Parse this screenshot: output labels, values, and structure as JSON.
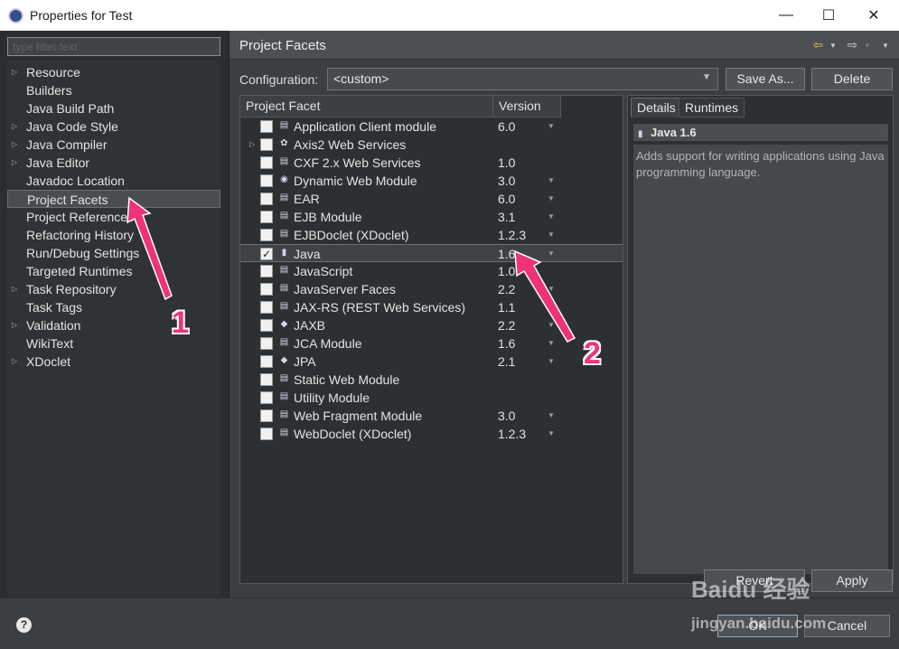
{
  "window": {
    "title": "Properties for Test",
    "minimize": "—",
    "maximize": "☐",
    "close": "✕"
  },
  "filter": {
    "placeholder": "type filter text"
  },
  "tree": {
    "items": [
      {
        "label": "Resource",
        "expandable": true
      },
      {
        "label": "Builders",
        "expandable": false
      },
      {
        "label": "Java Build Path",
        "expandable": false
      },
      {
        "label": "Java Code Style",
        "expandable": true
      },
      {
        "label": "Java Compiler",
        "expandable": true
      },
      {
        "label": "Java Editor",
        "expandable": true
      },
      {
        "label": "Javadoc Location",
        "expandable": false
      },
      {
        "label": "Project Facets",
        "expandable": false,
        "selected": true
      },
      {
        "label": "Project References",
        "expandable": false
      },
      {
        "label": "Refactoring History",
        "expandable": false
      },
      {
        "label": "Run/Debug Settings",
        "expandable": false
      },
      {
        "label": "Targeted Runtimes",
        "expandable": false
      },
      {
        "label": "Task Repository",
        "expandable": true
      },
      {
        "label": "Task Tags",
        "expandable": false
      },
      {
        "label": "Validation",
        "expandable": true
      },
      {
        "label": "WikiText",
        "expandable": false
      },
      {
        "label": "XDoclet",
        "expandable": true
      }
    ]
  },
  "header": {
    "title": "Project Facets",
    "back_icon": "back-arrow-icon",
    "forward_icon": "forward-arrow-icon"
  },
  "configuration": {
    "label": "Configuration:",
    "value": "<custom>",
    "save_as": "Save As...",
    "delete": "Delete"
  },
  "facets": {
    "col_facet": "Project Facet",
    "col_version": "Version",
    "rows": [
      {
        "name": "Application Client module",
        "version": "6.0",
        "checked": false,
        "chevron": true
      },
      {
        "name": "Axis2 Web Services",
        "version": "",
        "checked": false,
        "expand": true
      },
      {
        "name": "CXF 2.x Web Services",
        "version": "1.0",
        "checked": false
      },
      {
        "name": "Dynamic Web Module",
        "version": "3.0",
        "checked": false,
        "chevron": true
      },
      {
        "name": "EAR",
        "version": "6.0",
        "checked": false,
        "chevron": true
      },
      {
        "name": "EJB Module",
        "version": "3.1",
        "checked": false,
        "chevron": true
      },
      {
        "name": "EJBDoclet (XDoclet)",
        "version": "1.2.3",
        "checked": false,
        "chevron": true
      },
      {
        "name": "Java",
        "version": "1.6",
        "checked": true,
        "chevron": true,
        "selected": true
      },
      {
        "name": "JavaScript",
        "version": "1.0",
        "checked": false
      },
      {
        "name": "JavaServer Faces",
        "version": "2.2",
        "checked": false,
        "chevron": true
      },
      {
        "name": "JAX-RS (REST Web Services)",
        "version": "1.1",
        "checked": false
      },
      {
        "name": "JAXB",
        "version": "2.2",
        "checked": false,
        "chevron": true
      },
      {
        "name": "JCA Module",
        "version": "1.6",
        "checked": false,
        "chevron": true
      },
      {
        "name": "JPA",
        "version": "2.1",
        "checked": false,
        "chevron": true
      },
      {
        "name": "Static Web Module",
        "version": "",
        "checked": false
      },
      {
        "name": "Utility Module",
        "version": "",
        "checked": false
      },
      {
        "name": "Web Fragment Module",
        "version": "3.0",
        "checked": false,
        "chevron": true
      },
      {
        "name": "WebDoclet (XDoclet)",
        "version": "1.2.3",
        "checked": false,
        "chevron": true
      }
    ]
  },
  "details": {
    "tab_details": "Details",
    "tab_runtimes": "Runtimes",
    "title": "Java 1.6",
    "description": "Adds support for writing applications using Java programming language."
  },
  "buttons": {
    "revert": "Revert",
    "apply": "Apply",
    "ok": "OK",
    "cancel": "Cancel",
    "help": "?"
  },
  "annotations": {
    "one": "1",
    "two": "2",
    "accent": "#f0327a"
  },
  "watermark": {
    "line1": "Baidu 经验",
    "line2": "jingyan.baidu.com"
  }
}
